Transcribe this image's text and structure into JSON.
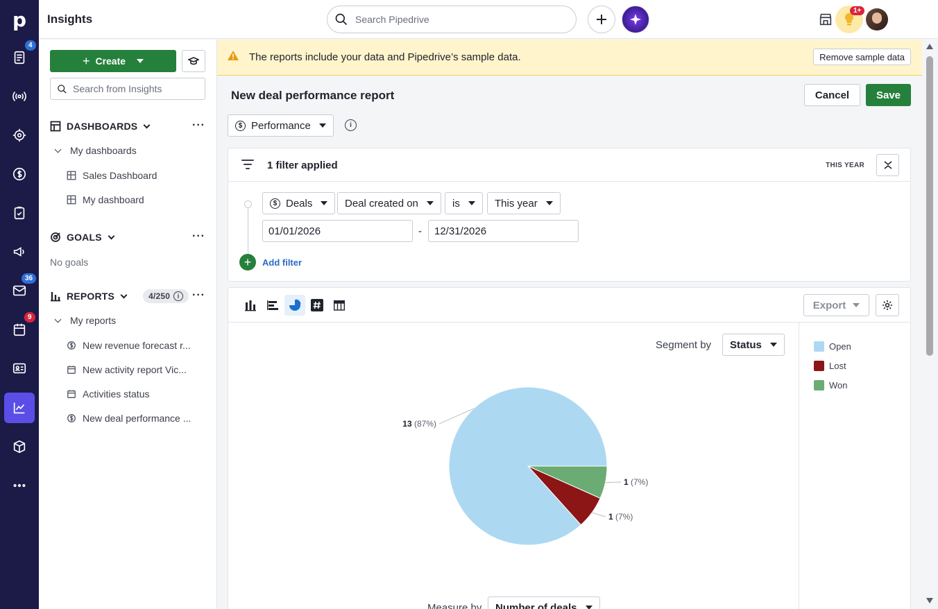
{
  "app": {
    "title": "Insights",
    "search_placeholder": "Search Pipedrive",
    "rail_badges": {
      "leads": "4",
      "mail": "36",
      "activities": "9"
    },
    "notification_badge": "1+"
  },
  "sidebar": {
    "create_label": "Create",
    "search_placeholder": "Search from Insights",
    "dashboards": {
      "heading": "DASHBOARDS",
      "group": "My dashboards",
      "items": [
        "Sales Dashboard",
        "My dashboard"
      ]
    },
    "goals": {
      "heading": "GOALS",
      "empty": "No goals"
    },
    "reports": {
      "heading": "REPORTS",
      "count": "4/250",
      "group": "My reports",
      "items": [
        {
          "label": "New revenue forecast r...",
          "icon": "revenue-icon"
        },
        {
          "label": "New activity report Vic...",
          "icon": "calendar-icon"
        },
        {
          "label": "Activities status",
          "icon": "calendar-icon"
        },
        {
          "label": "New deal performance ...",
          "icon": "dollar-icon"
        }
      ]
    }
  },
  "banner": {
    "message": "The reports include your data and Pipedrive’s sample data.",
    "remove_label": "Remove sample data"
  },
  "report": {
    "title": "New deal performance report",
    "cancel_label": "Cancel",
    "save_label": "Save",
    "type_label": "Performance"
  },
  "filters": {
    "summary": "1 filter applied",
    "period_tag": "THIS YEAR",
    "entity": "Deals",
    "field": "Deal created on",
    "operator": "is",
    "value": "This year",
    "date_from": "01/01/2026",
    "date_separator": "-",
    "date_to": "12/31/2026",
    "add_label": "Add filter"
  },
  "chart_panel": {
    "export_label": "Export",
    "segment_label": "Segment by",
    "segment_value": "Status",
    "measure_label": "Measure by",
    "measure_value": "Number of deals"
  },
  "chart_data": {
    "type": "pie",
    "categories": [
      "Open",
      "Lost",
      "Won"
    ],
    "values": [
      13,
      1,
      1
    ],
    "labels": [
      {
        "count": "13",
        "pct": "(87%)"
      },
      {
        "count": "1",
        "pct": "(7%)"
      },
      {
        "count": "1",
        "pct": "(7%)"
      }
    ],
    "colors": [
      "#add8f2",
      "#8c1515",
      "#6aac73"
    ],
    "legend_position": "right"
  }
}
